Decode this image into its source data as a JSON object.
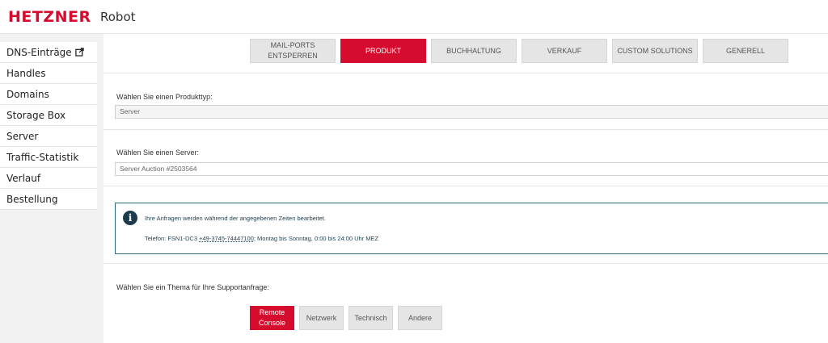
{
  "header": {
    "logo": "HETZNER",
    "app_name": "Robot"
  },
  "sidebar": {
    "items": [
      {
        "label": "DNS-Einträge",
        "external": true
      },
      {
        "label": "Handles"
      },
      {
        "label": "Domains"
      },
      {
        "label": "Storage Box"
      },
      {
        "label": "Server"
      },
      {
        "label": "Traffic-Statistik"
      },
      {
        "label": "Verlauf"
      },
      {
        "label": "Bestellung"
      }
    ]
  },
  "tabs": [
    {
      "line1": "MAIL-PORTS",
      "line2": "ENTSPERREN",
      "active": false
    },
    {
      "line1": "PRODUKT",
      "line2": "",
      "active": true
    },
    {
      "line1": "BUCHHALTUNG",
      "line2": "",
      "active": false
    },
    {
      "line1": "VERKAUF",
      "line2": "",
      "active": false
    },
    {
      "line1": "CUSTOM SOLUTIONS",
      "line2": "",
      "active": false
    },
    {
      "line1": "GENERELL",
      "line2": "",
      "active": false
    }
  ],
  "product_type": {
    "label": "Wählen Sie einen Produkttyp:",
    "value": "Server"
  },
  "server": {
    "label": "Wählen Sie einen Server:",
    "value": "Server Auction #2503564"
  },
  "info": {
    "message": "Ihre Anfragen werden während der angegebenen Zeiten bearbeitet.",
    "phone_prefix": "Telefon: FSN1-DC3 ",
    "phone_number": "+49-3745-74447100",
    "phone_suffix": "; Montag bis Sonntag, 0:00 bis 24:00 Uhr MEZ"
  },
  "topic": {
    "label": "Wählen Sie ein Thema für Ihre Supportanfrage:",
    "buttons": [
      {
        "line1": "Remote",
        "line2": "Console",
        "active": true
      },
      {
        "line1": "Netzwerk",
        "line2": "",
        "active": false
      },
      {
        "line1": "Technisch",
        "line2": "",
        "active": false
      },
      {
        "line1": "Andere",
        "line2": "",
        "active": false
      }
    ]
  },
  "colors": {
    "brand": "#d50c2d",
    "info_border": "#2f6a7a",
    "info_icon": "#1c3c4d"
  },
  "icons": {
    "external": "external-link-icon",
    "info": "info-icon"
  }
}
